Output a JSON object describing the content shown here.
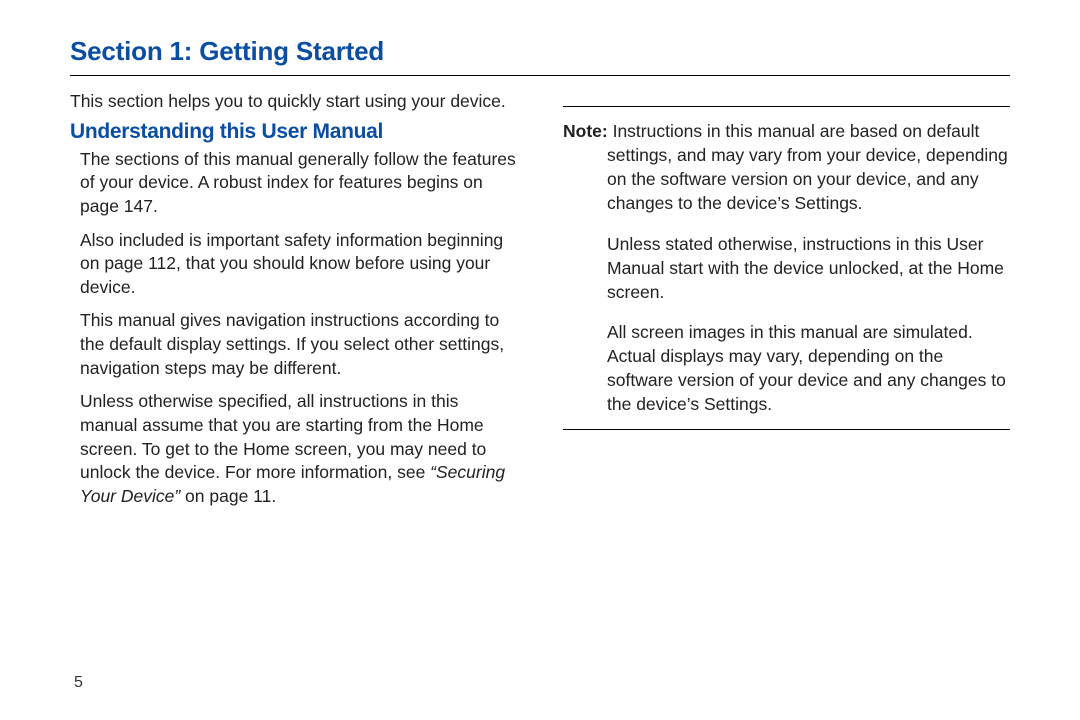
{
  "section_title": "Section 1: Getting Started",
  "left": {
    "intro": "This section helps you to quickly start using your device.",
    "subheading": "Understanding this User Manual",
    "p1": "The sections of this manual generally follow the features of your device. A robust index for features begins on page 147.",
    "p2": "Also included is important safety information beginning on page 112, that you should know before using your device.",
    "p3": "This manual gives navigation instructions according to the default display settings. If you select other settings, navigation steps may be different.",
    "p4a": "Unless otherwise specified, all instructions in this manual assume that you are starting from the Home screen. To get to the Home screen, you may need to unlock the device. For more information, see ",
    "p4b": "“Securing Your Device”",
    "p4c": " on page 11."
  },
  "right": {
    "note_label": "Note:",
    "n1": " Instructions in this manual are based on default settings, and may vary from your device, depending on the software version on your device, and any changes to the device’s Settings.",
    "n2": "Unless stated otherwise, instructions in this User Manual start with the device unlocked, at the Home screen.",
    "n3": "All screen images in this manual are simulated. Actual displays may vary, depending on the software version of your device and any changes to the device’s Settings."
  },
  "page_number": "5"
}
